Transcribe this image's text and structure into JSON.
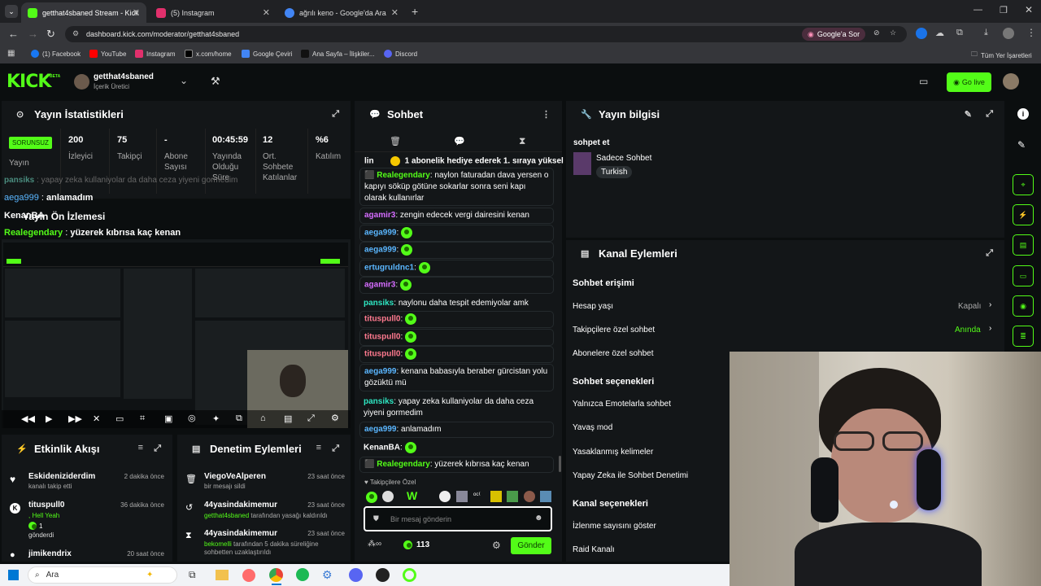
{
  "browser": {
    "tabs": [
      {
        "label": "getthat4sbaned Stream - Kick",
        "color": "#53fc18"
      },
      {
        "label": "(5) Instagram",
        "color": "#e1306c"
      },
      {
        "label": "ağrılı keno - Google'da Ara",
        "color": "#4285f4"
      }
    ],
    "url": "dashboard.kick.com/moderator/getthat4sbaned",
    "google_btn": "Google'a Sor",
    "bookmarks": [
      "(1) Facebook",
      "YouTube",
      "Instagram",
      "x.com/home",
      "Google Çeviri",
      "Ana Sayfa – İlişkiler...",
      "Discord"
    ],
    "all_bookmarks": "Tüm Yer İşaretleri"
  },
  "kick": {
    "logo": "KICK",
    "beta": "BETA",
    "channel": "getthat4sbaned",
    "role": "İçerik Üretici",
    "go_live": "Go live"
  },
  "stats": {
    "title": "Yayın İstatistikleri",
    "status_badge": "SORUNSUZ",
    "status_label": "Yayın",
    "items": [
      {
        "value": "200",
        "label": "İzleyici"
      },
      {
        "value": "75",
        "label": "Takipçi"
      },
      {
        "value": "-",
        "label": "Abone Sayısı"
      },
      {
        "value": "00:45:59",
        "label": "Yayında Olduğu Süre"
      },
      {
        "value": "12",
        "label": "Ort. Sohbete Katılanlar"
      },
      {
        "value": "%6",
        "label": "Katılım"
      }
    ]
  },
  "overlay": {
    "line1_name": "pansiks",
    "line1_text": "yapay zeka kullaniyolar da daha ceza yiyeni gormedim",
    "line2_name": "aega999",
    "line2_text": "anlamadım",
    "line3_name": "KenanBA",
    "preview_title": "Yayın Ön İzlemesi",
    "line4_name": "Realegendary",
    "line4_text": "yüzerek kıbrısa kaç kenan"
  },
  "chat": {
    "title": "Sohbet",
    "pinned": "1 abonelik hediye ederek 1. sıraya yüksel",
    "pinned_prefix": "lin",
    "messages": [
      {
        "name": "Realegendary",
        "color": "#53fc18",
        "text": "naylon faturadan dava yersen o kapıyı söküp götüne sokarlar sonra seni kapı olarak kullanırlar"
      },
      {
        "name": "agamir3",
        "color": "#d56cff",
        "text": "zengin edecek vergi dairesini kenan"
      },
      {
        "name": "aega999",
        "color": "#5ab6ff",
        "text": ""
      },
      {
        "name": "aega999",
        "color": "#5ab6ff",
        "text": ""
      },
      {
        "name": "ertugruldnc1",
        "color": "#5ab6ff",
        "text": ""
      },
      {
        "name": "agamir3",
        "color": "#d56cff",
        "text": ""
      },
      {
        "name": "pansiks",
        "color": "#2ee6c2",
        "text": "naylonu daha tespit edemiyolar amk"
      },
      {
        "name": "tituspull0",
        "color": "#ff7a8f",
        "text": ""
      },
      {
        "name": "tituspull0",
        "color": "#ff7a8f",
        "text": ""
      },
      {
        "name": "tituspull0",
        "color": "#ff7a8f",
        "text": ""
      },
      {
        "name": "aega999",
        "color": "#5ab6ff",
        "text": "kenana babasıyla beraber gürcistan yolu gözüktü mü"
      },
      {
        "name": "pansiks",
        "color": "#2ee6c2",
        "text": "yapay zeka kullaniyolar da daha ceza yiyeni gormedim"
      },
      {
        "name": "aega999",
        "color": "#5ab6ff",
        "text": "anlamadım"
      },
      {
        "name": "KenanBA",
        "color": "#ffffff",
        "text": ""
      },
      {
        "name": "Realegendary",
        "color": "#53fc18",
        "text": "yüzerek kıbrısa kaç kenan"
      }
    ],
    "followers_only": "Takipçilere Özel",
    "input_placeholder": "Bir mesaj gönderin",
    "points": "113",
    "send": "Gönder"
  },
  "info": {
    "title": "Yayın bilgisi",
    "stream_title": "sohpet et",
    "category": "Sadece Sohbet",
    "tag": "Turkish"
  },
  "actions": {
    "title": "Kanal Eylemleri",
    "s1": "Sohbet erişimi",
    "rows1": [
      {
        "label": "Hesap yaşı",
        "value": "Kapalı"
      },
      {
        "label": "Takipçilere özel sohbet",
        "value": "Anında"
      },
      {
        "label": "Abonelere özel sohbet",
        "value": ""
      }
    ],
    "s2": "Sohbet seçenekleri",
    "rows2": [
      "Yalnızca Emotelarla sohbet",
      "Yavaş mod",
      "Yasaklanmış kelimeler",
      "Yapay Zeka ile Sohbet Denetimi"
    ],
    "s3": "Kanal seçenekleri",
    "rows3": [
      "İzlenme sayısını göster",
      "Raid Kanalı"
    ]
  },
  "activity": {
    "title": "Etkinlik Akışı",
    "items": [
      {
        "name": "Eskideniziderdim",
        "sub": "kanalı takip etti",
        "time": "2 dakika önce"
      },
      {
        "name": "tituspull0",
        "sub": ", Hell Yeah",
        "sub2": "1",
        "sub3": "gönderdi",
        "time": "36 dakika önce"
      },
      {
        "name": "jimikendrix",
        "sub": "",
        "time": "20 saat önce"
      }
    ]
  },
  "moderation": {
    "title": "Denetim Eylemleri",
    "items": [
      {
        "name": "ViegoVeAlperen",
        "sub": "bir mesajı sildi",
        "time": "23 saat önce"
      },
      {
        "name": "44yasindakimemur",
        "hl": "getthat4sbaned",
        "sub": "tarafından yasağı kaldırıldı",
        "time": "23 saat önce"
      },
      {
        "name": "44yasindakimemur",
        "hl": "bekomelli",
        "sub": "tarafından 5 dakika süreliğine sohbetten uzaklaştırıldı",
        "time": "23 saat önce"
      }
    ]
  },
  "taskbar": {
    "search": "Ara"
  }
}
